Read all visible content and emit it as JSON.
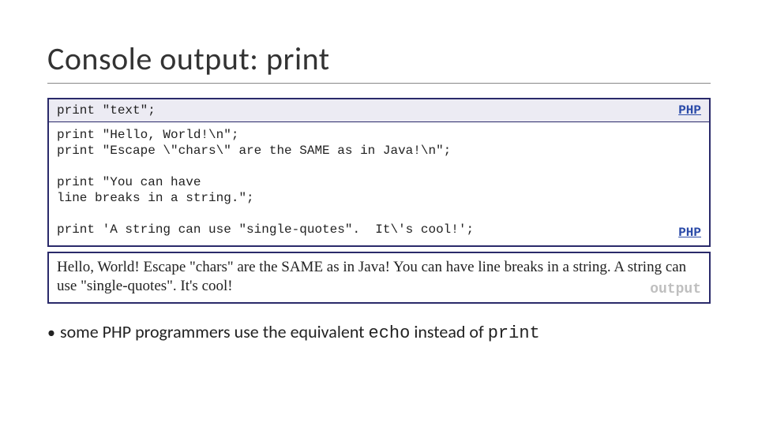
{
  "title": "Console output: print",
  "syntax_box": {
    "syntax_line": "print \"text\";",
    "lang_tag": "PHP",
    "body_lines": "print \"Hello, World!\\n\";\nprint \"Escape \\\"chars\\\" are the SAME as in Java!\\n\";\n\nprint \"You can have\nline breaks in a string.\";\n\nprint 'A string can use \"single-quotes\".  It\\'s cool!';",
    "bottom_tag": "PHP"
  },
  "output_box": {
    "text": "Hello, World! Escape \"chars\" are the SAME as in Java! You can have line breaks in a string. A string can use \"single-quotes\". It's cool!",
    "tag": "output"
  },
  "bullet": {
    "dot": "•",
    "pre": "some PHP programmers use the equivalent ",
    "code1": "echo",
    "mid": " instead of ",
    "code2": "print"
  }
}
